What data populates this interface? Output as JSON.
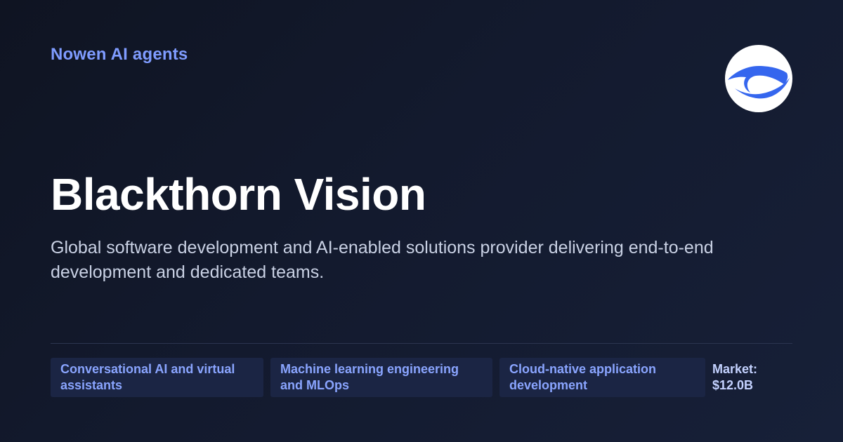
{
  "brand": "Nowen AI agents",
  "logo_icon": "blackthorn-eye-logo",
  "company": {
    "name": "Blackthorn Vision",
    "description": "Global software development and AI-enabled solutions provider delivering end-to-end development and dedicated teams."
  },
  "tags": [
    "Conversational AI and virtual assistants",
    "Machine learning engineering and MLOps",
    "Cloud-native application development"
  ],
  "market": {
    "label": "Market:",
    "value": "$12.0B"
  },
  "colors": {
    "accent": "#7f9cff",
    "tag_bg": "#1b2544",
    "logo_blue": "#3566ee"
  }
}
